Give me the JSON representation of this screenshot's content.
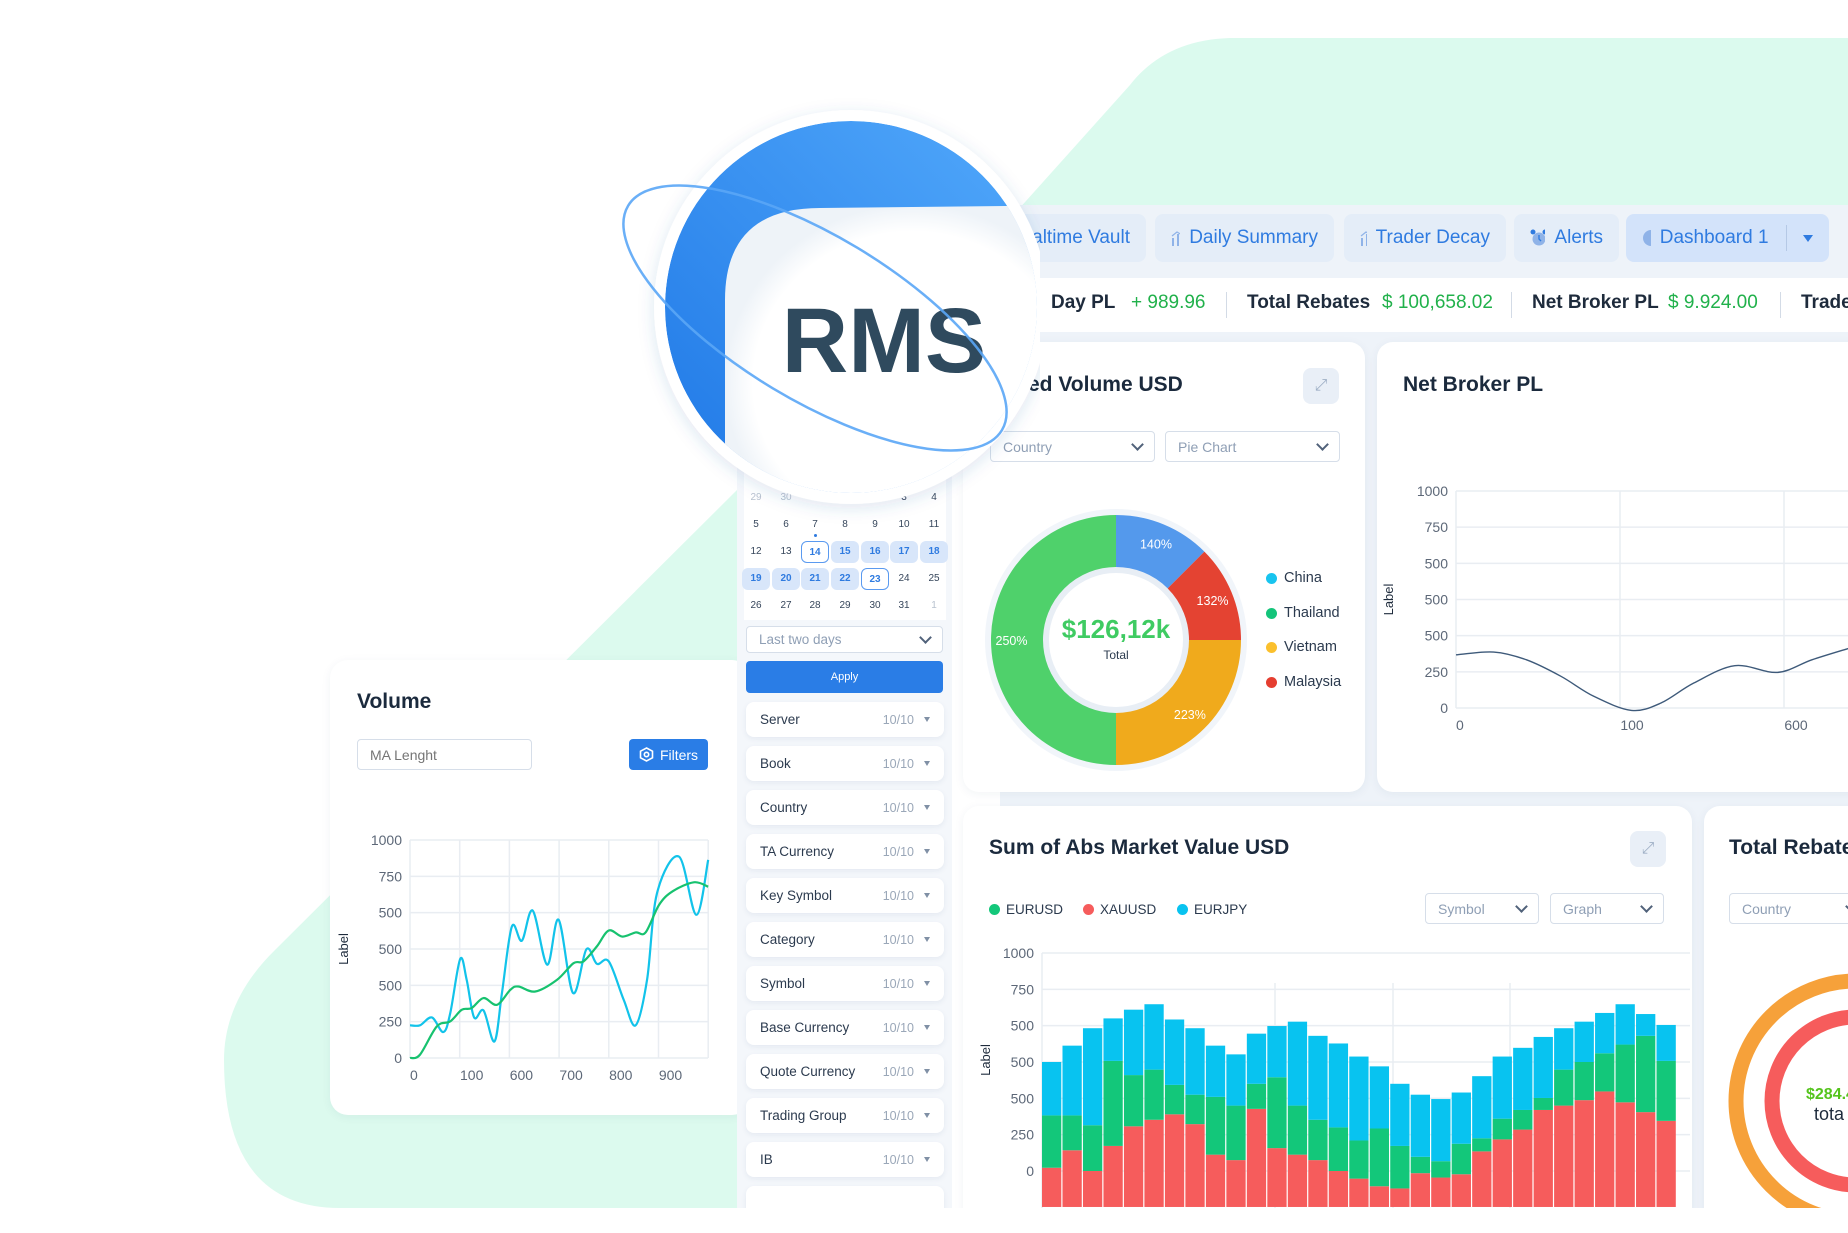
{
  "logo": {
    "text": "RMS",
    "colors": {
      "blue": "#2a82ea",
      "text": "#2f4a5e"
    }
  },
  "tabs": [
    {
      "label": "altime Vault",
      "icon": "none"
    },
    {
      "label": "Daily Summary",
      "icon": "bar-chart-icon"
    },
    {
      "label": "Trader Decay",
      "icon": "bar-chart-icon"
    },
    {
      "label": "Alerts",
      "icon": "alarm-clock-icon"
    },
    {
      "label": "Dashboard 1",
      "icon": "pie-chart-icon",
      "active": true,
      "has_dropdown": true
    }
  ],
  "stats": [
    {
      "label": "Day PL",
      "value": "+ 989.96"
    },
    {
      "label": "Total Rebates",
      "value": "$ 100,658.02"
    },
    {
      "label": "Net Broker PL",
      "value": "$ 9.924.00"
    },
    {
      "label": "Trade",
      "value": ""
    }
  ],
  "calendar": {
    "rows": [
      [
        "29",
        "30",
        "",
        "",
        "",
        "3",
        "4"
      ],
      [
        "5",
        "6",
        "7",
        "8",
        "9",
        "10",
        "11"
      ],
      [
        "12",
        "13",
        "14",
        "15",
        "16",
        "17",
        "18"
      ],
      [
        "19",
        "20",
        "21",
        "22",
        "23",
        "24",
        "25"
      ],
      [
        "26",
        "27",
        "28",
        "29",
        "30",
        "31",
        "1"
      ]
    ],
    "range_start": "14",
    "range_end": "23",
    "today": "7",
    "preset": "Last two days",
    "apply_label": "Apply"
  },
  "filters": [
    {
      "label": "Server",
      "count": "10/10"
    },
    {
      "label": "Book",
      "count": "10/10"
    },
    {
      "label": "Country",
      "count": "10/10"
    },
    {
      "label": "TA Currency",
      "count": "10/10"
    },
    {
      "label": "Key Symbol",
      "count": "10/10"
    },
    {
      "label": "Category",
      "count": "10/10"
    },
    {
      "label": "Symbol",
      "count": "10/10"
    },
    {
      "label": "Base Currency",
      "count": "10/10"
    },
    {
      "label": "Quote Currency",
      "count": "10/10"
    },
    {
      "label": "Trading Group",
      "count": "10/10"
    },
    {
      "label": "IB",
      "count": "10/10"
    }
  ],
  "volume_card": {
    "title": "Volume",
    "ma_placeholder": "MA Lenght",
    "filters_label": "Filters"
  },
  "traded_card": {
    "title": "ed Volume USD",
    "dropdown1": "Country",
    "dropdown2": "Pie Chart",
    "center_value": "$126,12k",
    "center_label": "Total"
  },
  "net_card": {
    "title": "Net Broker PL"
  },
  "sum_card": {
    "title": "Sum of Abs Market Value USD",
    "dropdown1": "Symbol",
    "dropdown2": "Graph"
  },
  "rebate_card": {
    "title": "Total Rebate",
    "dropdown": "Country",
    "center_value": "$284.4",
    "center_label": "tota"
  },
  "chart_data": [
    {
      "id": "volume",
      "type": "line",
      "ylabel": "Label",
      "ylim": [
        0,
        1000
      ],
      "ytick_labels": [
        "1000",
        "750",
        "500",
        "500",
        "500",
        "250",
        "0"
      ],
      "xtick_labels": [
        "0",
        "100",
        "600",
        "700",
        "800",
        "900"
      ],
      "xlim": [
        0,
        6
      ],
      "grid": true,
      "series": [
        {
          "color": "#12c3ea",
          "x": [
            0,
            0.2,
            0.44,
            0.67,
            0.81,
            1.01,
            1.14,
            1.29,
            1.48,
            1.7,
            1.85,
            2.05,
            2.25,
            2.47,
            2.76,
            2.99,
            3.28,
            3.55,
            3.76,
            4.0,
            4.3,
            4.54,
            4.77,
            4.97,
            5.41,
            5.76,
            6.0
          ],
          "y": [
            150,
            150,
            186,
            119,
            206,
            454,
            359,
            186,
            218,
            76,
            298,
            603,
            538,
            676,
            428,
            634,
            298,
            499,
            432,
            443,
            267,
            150,
            359,
            756,
            924,
            657,
            909
          ]
        },
        {
          "color": "#17c26f",
          "x": [
            0,
            0.2,
            0.54,
            0.81,
            1.04,
            1.24,
            1.48,
            1.75,
            2.02,
            2.18,
            2.52,
            2.96,
            3.29,
            3.49,
            3.76,
            4.0,
            4.27,
            4.54,
            4.74,
            5.01,
            5.28,
            5.71,
            6.0
          ],
          "y": [
            0,
            15,
            145,
            168,
            221,
            229,
            275,
            244,
            313,
            328,
            305,
            359,
            435,
            443,
            512,
            585,
            557,
            576,
            576,
            702,
            764,
            806,
            786
          ]
        }
      ]
    },
    {
      "id": "traded",
      "type": "pie",
      "segments": [
        {
          "label": "140%",
          "share": 0.125,
          "color": "#5499ec"
        },
        {
          "label": "132%",
          "share": 0.125,
          "color": "#e44332"
        },
        {
          "label": "223%",
          "share": 0.25,
          "color": "#f0aa1c"
        },
        {
          "label": "250%",
          "share": 0.5,
          "color": "#4fd16b"
        }
      ],
      "legend": [
        {
          "name": "China",
          "color": "#18c4ef"
        },
        {
          "name": "Thailand",
          "color": "#14c47a"
        },
        {
          "name": "Vietnam",
          "color": "#fbc02d"
        },
        {
          "name": "Malaysia",
          "color": "#e53e30"
        }
      ],
      "legend_position": "right"
    },
    {
      "id": "net",
      "type": "line",
      "ylabel": "Label",
      "ylim": [
        0,
        1000
      ],
      "ytick_labels": [
        "1000",
        "750",
        "500",
        "500",
        "500",
        "250",
        "0"
      ],
      "xtick_labels": [
        "0",
        "100",
        "600"
      ],
      "xlim": [
        0,
        2.4
      ],
      "grid": true,
      "series": [
        {
          "color": "#3e5a7a",
          "x": [
            0,
            0.23,
            0.43,
            0.64,
            0.84,
            1.07,
            1.25,
            1.45,
            1.7,
            1.96,
            2.17,
            2.4
          ],
          "y": [
            245,
            258,
            222,
            146,
            54,
            -11,
            23,
            115,
            195,
            164,
            222,
            276
          ]
        }
      ]
    },
    {
      "id": "sum",
      "type": "bar",
      "stacked": true,
      "ylabel": "Label",
      "ylim": [
        -165,
        1000
      ],
      "ytick_labels": [
        "1000",
        "750",
        "500",
        "500",
        "500",
        "250",
        "0"
      ],
      "legend_position": "top-left",
      "series": [
        {
          "name": "XAUUSD",
          "color": "#f65c5c",
          "values": [
            180,
            260,
            165,
            280,
            370,
            400,
            425,
            380,
            240,
            215,
            450,
            270,
            240,
            215,
            165,
            130,
            95,
            85,
            155,
            135,
            150,
            255,
            310,
            355,
            445,
            465,
            490,
            530,
            480,
            435,
            395
          ]
        },
        {
          "name": "EURUSD",
          "color": "#13c77a",
          "values": [
            240,
            160,
            210,
            390,
            235,
            230,
            135,
            135,
            265,
            250,
            115,
            325,
            225,
            185,
            200,
            175,
            265,
            195,
            75,
            75,
            140,
            60,
            95,
            90,
            55,
            165,
            175,
            175,
            265,
            350,
            275
          ]
        },
        {
          "name": "EURJPY",
          "color": "#08c3f0",
          "values": [
            245,
            320,
            445,
            195,
            300,
            300,
            300,
            305,
            235,
            235,
            230,
            235,
            385,
            385,
            385,
            385,
            285,
            285,
            285,
            285,
            235,
            285,
            285,
            285,
            280,
            190,
            185,
            185,
            185,
            100,
            165
          ]
        }
      ],
      "legend_order": [
        "EURUSD",
        "XAUUSD",
        "EURJPY"
      ]
    },
    {
      "id": "rebate",
      "type": "pie",
      "rings": [
        {
          "color": "#f6a13a"
        },
        {
          "color": "#f65c5c"
        }
      ]
    }
  ]
}
